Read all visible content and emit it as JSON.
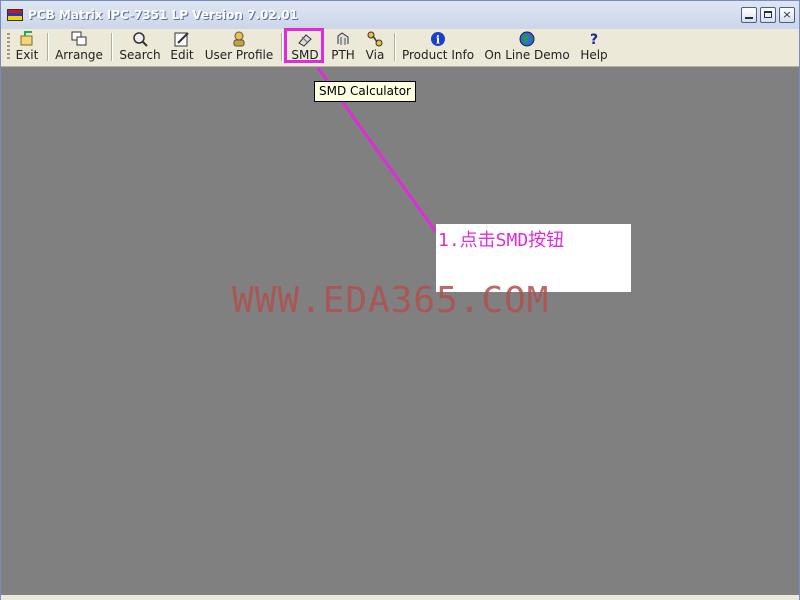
{
  "window": {
    "title": "PCB Matrix IPC-7351 LP Version  7.02.01",
    "controls": {
      "minimize": "minimize",
      "maximize": "maximize",
      "close": "×"
    }
  },
  "toolbar": {
    "items": [
      {
        "label": "Exit",
        "icon": "exit-icon"
      },
      {
        "label": "Arrange",
        "icon": "arrange-icon"
      },
      {
        "label": "Search",
        "icon": "search-icon"
      },
      {
        "label": "Edit",
        "icon": "edit-icon"
      },
      {
        "label": "User Profile",
        "icon": "user-profile-icon"
      },
      {
        "label": "SMD",
        "icon": "smd-icon"
      },
      {
        "label": "PTH",
        "icon": "pth-icon"
      },
      {
        "label": "Via",
        "icon": "via-icon"
      },
      {
        "label": "Product Info",
        "icon": "info-icon"
      },
      {
        "label": "On Line Demo",
        "icon": "globe-icon"
      },
      {
        "label": "Help",
        "icon": "help-icon"
      }
    ]
  },
  "tooltip": {
    "text": "SMD Calculator"
  },
  "annotation": {
    "text": "1.点击SMD按钮",
    "color": "#e02bdc"
  },
  "watermark": {
    "text": "WWW.EDA365.COM"
  },
  "colors": {
    "workspace": "#808080",
    "toolbar": "#ece9d8",
    "highlight": "#e02bdc"
  }
}
